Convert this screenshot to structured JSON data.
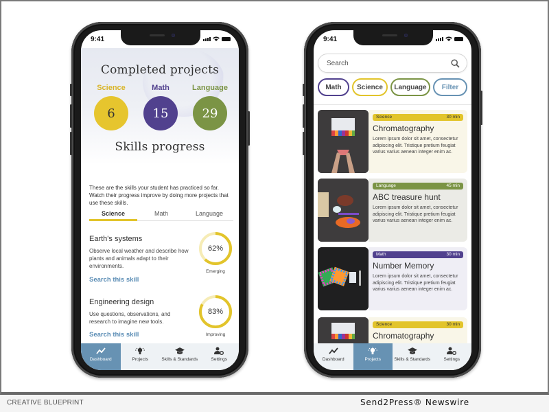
{
  "footer": {
    "left_text": "CREATIVE BLUEPRINT",
    "right_text": "Send2Press® Newswire"
  },
  "colors": {
    "science": "#e2c42b",
    "math": "#51418e",
    "language": "#7b9445",
    "accent_blue": "#6792b3",
    "link": "#5b8db5"
  },
  "phone_left": {
    "status_time": "9:41",
    "title": "Completed projects",
    "counts": [
      {
        "label": "Science",
        "value": "6"
      },
      {
        "label": "Math",
        "value": "15"
      },
      {
        "label": "Language",
        "value": "29"
      }
    ],
    "skills_title": "Skills progress",
    "description": "These are the skills your student has practiced so far. Watch their progress improve by doing more projects that use these skills.",
    "tabs": [
      {
        "label": "Science",
        "active": true
      },
      {
        "label": "Math",
        "active": false
      },
      {
        "label": "Language",
        "active": false
      }
    ],
    "skills": [
      {
        "name": "Earth's systems",
        "description": "Observe local weather and describe how plants and animals adapt to their environments.",
        "link": "Search this skill",
        "percent": 62,
        "percent_label": "62%",
        "level": "Emerging"
      },
      {
        "name": "Engineering design",
        "description": "Use questions, observations, and research to imagine new tools.",
        "link": "Search this skill",
        "percent": 83,
        "percent_label": "83%",
        "level": "Improving"
      }
    ],
    "nav": [
      {
        "label": "Dashboard",
        "icon": "trend-icon",
        "active": true
      },
      {
        "label": "Projects",
        "icon": "lightbulb-icon",
        "active": false
      },
      {
        "label": "Skills & Standards",
        "icon": "graduation-cap-icon",
        "active": false
      },
      {
        "label": "Settings",
        "icon": "user-gear-icon",
        "active": false
      }
    ]
  },
  "phone_right": {
    "status_time": "9:41",
    "search_placeholder": "Search",
    "chips": [
      {
        "label": "Math"
      },
      {
        "label": "Science"
      },
      {
        "label": "Language"
      },
      {
        "label": "Filter"
      }
    ],
    "cards": [
      {
        "subject": "Science",
        "duration": "30 min",
        "title": "Chromatography",
        "description": "Lorem ipsum dolor sit amet, consectetur adipiscing elit. Tristique pretium feugiat varius varius aenean integer enim ac."
      },
      {
        "subject": "Language",
        "duration": "45 min",
        "title": "ABC treasure hunt",
        "description": "Lorem ipsum dolor sit amet, consectetur adipiscing elit. Tristique pretium feugiat varius varius aenean integer enim ac."
      },
      {
        "subject": "Math",
        "duration": "30 min",
        "title": "Number Memory",
        "description": "Lorem ipsum dolor sit amet, consectetur adipiscing elit. Tristique pretium feugiat varius varius aenean integer enim ac."
      },
      {
        "subject": "Science",
        "duration": "30 min",
        "title": "Chromatography",
        "description": ""
      }
    ],
    "nav": [
      {
        "label": "Dashboard",
        "icon": "trend-icon",
        "active": false
      },
      {
        "label": "Projects",
        "icon": "lightbulb-icon",
        "active": true
      },
      {
        "label": "Skills & Standards",
        "icon": "graduation-cap-icon",
        "active": false
      },
      {
        "label": "Settings",
        "icon": "user-gear-icon",
        "active": false
      }
    ]
  }
}
